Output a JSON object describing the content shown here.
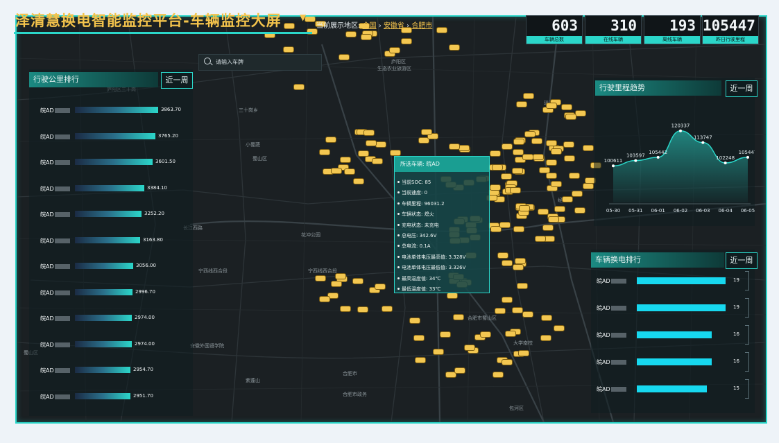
{
  "header": {
    "title": "泽清慧换电智能监控平台-车辆监控大屏",
    "region_label": "当前展示地区:",
    "breadcrumb": [
      "全国",
      "安徽省",
      "合肥市"
    ]
  },
  "stats": [
    {
      "value": "603",
      "label": "车辆总数"
    },
    {
      "value": "310",
      "label": "在线车辆"
    },
    {
      "value": "193",
      "label": "离线车辆"
    },
    {
      "value": "105447",
      "label": "昨日行驶里程"
    }
  ],
  "left_panel": {
    "title": "行驶公里排行",
    "button": "近一周",
    "plate_prefix": "皖AD",
    "items": [
      {
        "value": "3863.70",
        "fraction": 1.0
      },
      {
        "value": "3765.20",
        "fraction": 0.97
      },
      {
        "value": "3601.50",
        "fraction": 0.93
      },
      {
        "value": "3384.10",
        "fraction": 0.83
      },
      {
        "value": "3252.20",
        "fraction": 0.8
      },
      {
        "value": "3163.80",
        "fraction": 0.78
      },
      {
        "value": "3056.00",
        "fraction": 0.7
      },
      {
        "value": "2996.70",
        "fraction": 0.69
      },
      {
        "value": "2974.00",
        "fraction": 0.68
      },
      {
        "value": "2974.00",
        "fraction": 0.68
      },
      {
        "value": "2954.70",
        "fraction": 0.67
      },
      {
        "value": "2951.70",
        "fraction": 0.67
      }
    ]
  },
  "search": {
    "placeholder": "请输入车牌"
  },
  "tooltip": {
    "title": "所选车辆: 皖AD",
    "rows": [
      "当前SOC: 85",
      "当前速度: 0",
      "车辆里程: 96031.2",
      "车辆状态: 熄火",
      "充电状态: 未充电",
      "总电压: 342.6V",
      "总电流: 0.1A",
      "电池单体电压最高值: 3.328V",
      "电池单体电压最低值: 3.326V",
      "最高温度值: 34℃",
      "最低温度值: 33℃"
    ]
  },
  "trend_panel": {
    "title": "行驶里程趋势",
    "button": "近一周",
    "color": "#2bd6c9"
  },
  "chart_data": {
    "type": "area",
    "x": [
      "05-30",
      "05-31",
      "06-01",
      "06-02",
      "06-03",
      "06-04",
      "06-05"
    ],
    "values": [
      100611,
      103597,
      105442,
      120337,
      113747,
      102248,
      105447
    ],
    "point_labels": [
      "100611",
      "103597",
      "105442",
      "120337",
      "113747",
      "102248",
      "105447"
    ],
    "ylim": [
      80000,
      130000
    ],
    "grid": false
  },
  "swap_panel": {
    "title": "车辆换电排行",
    "button": "近一周",
    "plate_prefix": "皖AD",
    "bar_color": "#17d8ef",
    "items": [
      {
        "value": "19",
        "fraction": 1.0
      },
      {
        "value": "19",
        "fraction": 1.0
      },
      {
        "value": "16",
        "fraction": 0.84
      },
      {
        "value": "16",
        "fraction": 0.84
      },
      {
        "value": "15",
        "fraction": 0.79
      }
    ]
  },
  "map": {
    "labels": [
      "长江西路",
      "宁西线西合段",
      "宁西线西合段",
      "合肥市蜀山区",
      "合肥市",
      "蜀山区",
      "庐阳区",
      "大学南校",
      "小蜀蔬",
      "三十岗乡",
      "花冲公园",
      "安徽外国语学院",
      "紫蓬山",
      "合肥市政务",
      "包河区",
      "瑶海区",
      "庐阳区三十岗",
      "生态农业旅游区",
      "蜀山区",
      "经开区"
    ]
  }
}
